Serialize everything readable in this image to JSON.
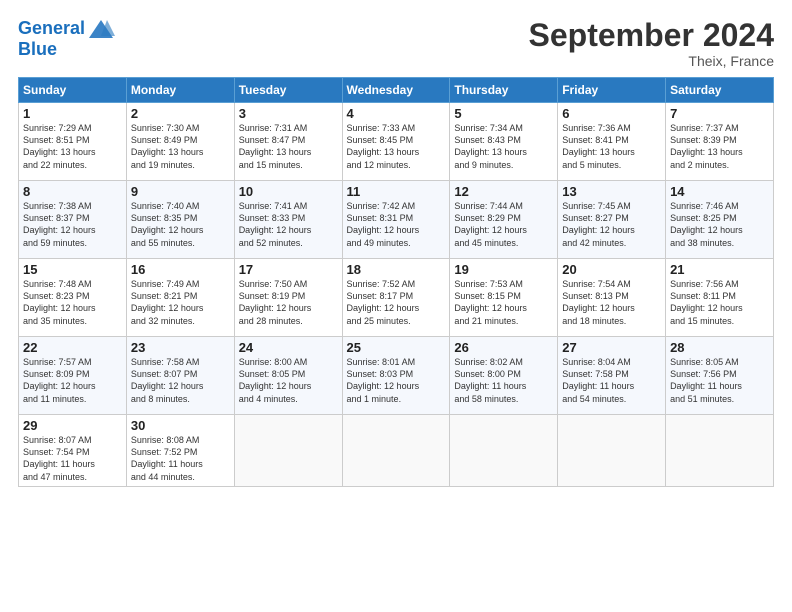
{
  "header": {
    "logo_line1": "General",
    "logo_line2": "Blue",
    "title": "September 2024",
    "location": "Theix, France"
  },
  "days_of_week": [
    "Sunday",
    "Monday",
    "Tuesday",
    "Wednesday",
    "Thursday",
    "Friday",
    "Saturday"
  ],
  "weeks": [
    [
      {
        "day": 1,
        "lines": [
          "Sunrise: 7:29 AM",
          "Sunset: 8:51 PM",
          "Daylight: 13 hours",
          "and 22 minutes."
        ]
      },
      {
        "day": 2,
        "lines": [
          "Sunrise: 7:30 AM",
          "Sunset: 8:49 PM",
          "Daylight: 13 hours",
          "and 19 minutes."
        ]
      },
      {
        "day": 3,
        "lines": [
          "Sunrise: 7:31 AM",
          "Sunset: 8:47 PM",
          "Daylight: 13 hours",
          "and 15 minutes."
        ]
      },
      {
        "day": 4,
        "lines": [
          "Sunrise: 7:33 AM",
          "Sunset: 8:45 PM",
          "Daylight: 13 hours",
          "and 12 minutes."
        ]
      },
      {
        "day": 5,
        "lines": [
          "Sunrise: 7:34 AM",
          "Sunset: 8:43 PM",
          "Daylight: 13 hours",
          "and 9 minutes."
        ]
      },
      {
        "day": 6,
        "lines": [
          "Sunrise: 7:36 AM",
          "Sunset: 8:41 PM",
          "Daylight: 13 hours",
          "and 5 minutes."
        ]
      },
      {
        "day": 7,
        "lines": [
          "Sunrise: 7:37 AM",
          "Sunset: 8:39 PM",
          "Daylight: 13 hours",
          "and 2 minutes."
        ]
      }
    ],
    [
      {
        "day": 8,
        "lines": [
          "Sunrise: 7:38 AM",
          "Sunset: 8:37 PM",
          "Daylight: 12 hours",
          "and 59 minutes."
        ]
      },
      {
        "day": 9,
        "lines": [
          "Sunrise: 7:40 AM",
          "Sunset: 8:35 PM",
          "Daylight: 12 hours",
          "and 55 minutes."
        ]
      },
      {
        "day": 10,
        "lines": [
          "Sunrise: 7:41 AM",
          "Sunset: 8:33 PM",
          "Daylight: 12 hours",
          "and 52 minutes."
        ]
      },
      {
        "day": 11,
        "lines": [
          "Sunrise: 7:42 AM",
          "Sunset: 8:31 PM",
          "Daylight: 12 hours",
          "and 49 minutes."
        ]
      },
      {
        "day": 12,
        "lines": [
          "Sunrise: 7:44 AM",
          "Sunset: 8:29 PM",
          "Daylight: 12 hours",
          "and 45 minutes."
        ]
      },
      {
        "day": 13,
        "lines": [
          "Sunrise: 7:45 AM",
          "Sunset: 8:27 PM",
          "Daylight: 12 hours",
          "and 42 minutes."
        ]
      },
      {
        "day": 14,
        "lines": [
          "Sunrise: 7:46 AM",
          "Sunset: 8:25 PM",
          "Daylight: 12 hours",
          "and 38 minutes."
        ]
      }
    ],
    [
      {
        "day": 15,
        "lines": [
          "Sunrise: 7:48 AM",
          "Sunset: 8:23 PM",
          "Daylight: 12 hours",
          "and 35 minutes."
        ]
      },
      {
        "day": 16,
        "lines": [
          "Sunrise: 7:49 AM",
          "Sunset: 8:21 PM",
          "Daylight: 12 hours",
          "and 32 minutes."
        ]
      },
      {
        "day": 17,
        "lines": [
          "Sunrise: 7:50 AM",
          "Sunset: 8:19 PM",
          "Daylight: 12 hours",
          "and 28 minutes."
        ]
      },
      {
        "day": 18,
        "lines": [
          "Sunrise: 7:52 AM",
          "Sunset: 8:17 PM",
          "Daylight: 12 hours",
          "and 25 minutes."
        ]
      },
      {
        "day": 19,
        "lines": [
          "Sunrise: 7:53 AM",
          "Sunset: 8:15 PM",
          "Daylight: 12 hours",
          "and 21 minutes."
        ]
      },
      {
        "day": 20,
        "lines": [
          "Sunrise: 7:54 AM",
          "Sunset: 8:13 PM",
          "Daylight: 12 hours",
          "and 18 minutes."
        ]
      },
      {
        "day": 21,
        "lines": [
          "Sunrise: 7:56 AM",
          "Sunset: 8:11 PM",
          "Daylight: 12 hours",
          "and 15 minutes."
        ]
      }
    ],
    [
      {
        "day": 22,
        "lines": [
          "Sunrise: 7:57 AM",
          "Sunset: 8:09 PM",
          "Daylight: 12 hours",
          "and 11 minutes."
        ]
      },
      {
        "day": 23,
        "lines": [
          "Sunrise: 7:58 AM",
          "Sunset: 8:07 PM",
          "Daylight: 12 hours",
          "and 8 minutes."
        ]
      },
      {
        "day": 24,
        "lines": [
          "Sunrise: 8:00 AM",
          "Sunset: 8:05 PM",
          "Daylight: 12 hours",
          "and 4 minutes."
        ]
      },
      {
        "day": 25,
        "lines": [
          "Sunrise: 8:01 AM",
          "Sunset: 8:03 PM",
          "Daylight: 12 hours",
          "and 1 minute."
        ]
      },
      {
        "day": 26,
        "lines": [
          "Sunrise: 8:02 AM",
          "Sunset: 8:00 PM",
          "Daylight: 11 hours",
          "and 58 minutes."
        ]
      },
      {
        "day": 27,
        "lines": [
          "Sunrise: 8:04 AM",
          "Sunset: 7:58 PM",
          "Daylight: 11 hours",
          "and 54 minutes."
        ]
      },
      {
        "day": 28,
        "lines": [
          "Sunrise: 8:05 AM",
          "Sunset: 7:56 PM",
          "Daylight: 11 hours",
          "and 51 minutes."
        ]
      }
    ],
    [
      {
        "day": 29,
        "lines": [
          "Sunrise: 8:07 AM",
          "Sunset: 7:54 PM",
          "Daylight: 11 hours",
          "and 47 minutes."
        ]
      },
      {
        "day": 30,
        "lines": [
          "Sunrise: 8:08 AM",
          "Sunset: 7:52 PM",
          "Daylight: 11 hours",
          "and 44 minutes."
        ]
      },
      null,
      null,
      null,
      null,
      null
    ]
  ]
}
